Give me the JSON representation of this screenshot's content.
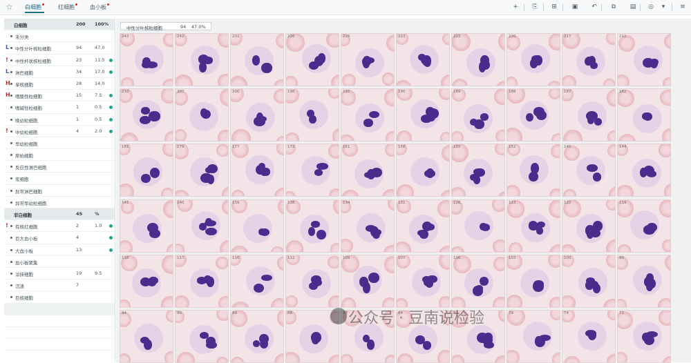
{
  "toolbar": {
    "tabs": [
      {
        "label": "白细胞",
        "active": true,
        "dot": true
      },
      {
        "label": "红细胞",
        "active": false,
        "dot": true
      },
      {
        "label": "血小板",
        "active": false,
        "dot": true
      }
    ],
    "tools": [
      "+",
      "⎘",
      "⊞",
      "▣",
      "↶",
      "⧉",
      "▤",
      "◎",
      "▾",
      "≡"
    ]
  },
  "left_panel": {
    "wbc_header": {
      "name": "白细胞",
      "count": "200",
      "pct": "100%"
    },
    "wbc_rows": [
      {
        "flag": "",
        "name": "未分类",
        "count": "",
        "pct": "",
        "dot": false
      },
      {
        "flag": "L",
        "name": "中性分叶核粒细胞",
        "count": "94",
        "pct": "47.0",
        "dot": false
      },
      {
        "flag": "!",
        "name": "中性杆状核粒细胞",
        "count": "23",
        "pct": "11.5",
        "dot": true
      },
      {
        "flag": "L",
        "name": "淋巴细胞",
        "count": "34",
        "pct": "17.0",
        "dot": true
      },
      {
        "flag": "H",
        "name": "单核细胞",
        "count": "28",
        "pct": "14.0",
        "dot": false
      },
      {
        "flag": "H",
        "name": "嗜酸性粒细胞",
        "count": "15",
        "pct": "7.5",
        "dot": true
      },
      {
        "flag": "",
        "name": "嗜碱性粒细胞",
        "count": "1",
        "pct": "0.5",
        "dot": true
      },
      {
        "flag": "",
        "name": "晚幼粒细胞",
        "count": "1",
        "pct": "0.5",
        "dot": true
      },
      {
        "flag": "!",
        "name": "中幼粒细胞",
        "count": "4",
        "pct": "2.0",
        "dot": true
      },
      {
        "flag": "",
        "name": "早幼粒细胞",
        "count": "",
        "pct": "",
        "dot": false
      },
      {
        "flag": "",
        "name": "原始细胞",
        "count": "",
        "pct": "",
        "dot": false
      },
      {
        "flag": "",
        "name": "反应性淋巴细胞",
        "count": "",
        "pct": "",
        "dot": false
      },
      {
        "flag": "",
        "name": "浆细胞",
        "count": "",
        "pct": "",
        "dot": false
      },
      {
        "flag": "",
        "name": "异常淋巴细胞",
        "count": "",
        "pct": "",
        "dot": false
      },
      {
        "flag": "",
        "name": "异常早幼粒细胞",
        "count": "",
        "pct": "",
        "dot": false
      }
    ],
    "nonwbc_header": {
      "name": "非白细胞",
      "count": "45",
      "pct": "%"
    },
    "nonwbc_rows": [
      {
        "flag": "!",
        "name": "有核红细胞",
        "count": "2",
        "pct": "1.0",
        "dot": true
      },
      {
        "flag": "",
        "name": "巨大血小板",
        "count": "4",
        "pct": "",
        "dot": true
      },
      {
        "flag": "",
        "name": "大血小板",
        "count": "13",
        "pct": "",
        "dot": true
      },
      {
        "flag": "",
        "name": "血小板聚集",
        "count": "",
        "pct": "",
        "dot": false
      },
      {
        "flag": "",
        "name": "涂抹细胞",
        "count": "19",
        "pct": "9.5",
        "dot": false
      },
      {
        "flag": "",
        "name": "沉渣",
        "count": "7",
        "pct": "",
        "dot": false
      },
      {
        "flag": "",
        "name": "巨核细胞",
        "count": "",
        "pct": "",
        "dot": false
      }
    ]
  },
  "main": {
    "selected": {
      "name": "中性分叶核粒细胞",
      "count": "94",
      "pct": "47.0%"
    },
    "tile_numbers": [
      [
        "243",
        "242",
        "231",
        "226",
        "225",
        "223",
        "222",
        "220",
        "217",
        "212"
      ],
      [
        "210",
        "207",
        "200",
        "198",
        "192",
        "190",
        "189",
        "188",
        "187",
        "182"
      ],
      [
        "181",
        "179",
        "177",
        "172",
        "161",
        "158",
        "155",
        "152",
        "145",
        "144"
      ],
      [
        "141",
        "140",
        "139",
        "138",
        "134",
        "131",
        "126",
        "123",
        "122",
        "119"
      ],
      [
        "118",
        "117",
        "116",
        "112",
        "109",
        "107",
        "106",
        "103",
        "100",
        "99"
      ],
      [
        "94",
        "90",
        "89",
        "88",
        "87",
        "84",
        "81",
        "79",
        "74",
        "71"
      ]
    ]
  },
  "watermark": "公众号 · 豆南说检验"
}
